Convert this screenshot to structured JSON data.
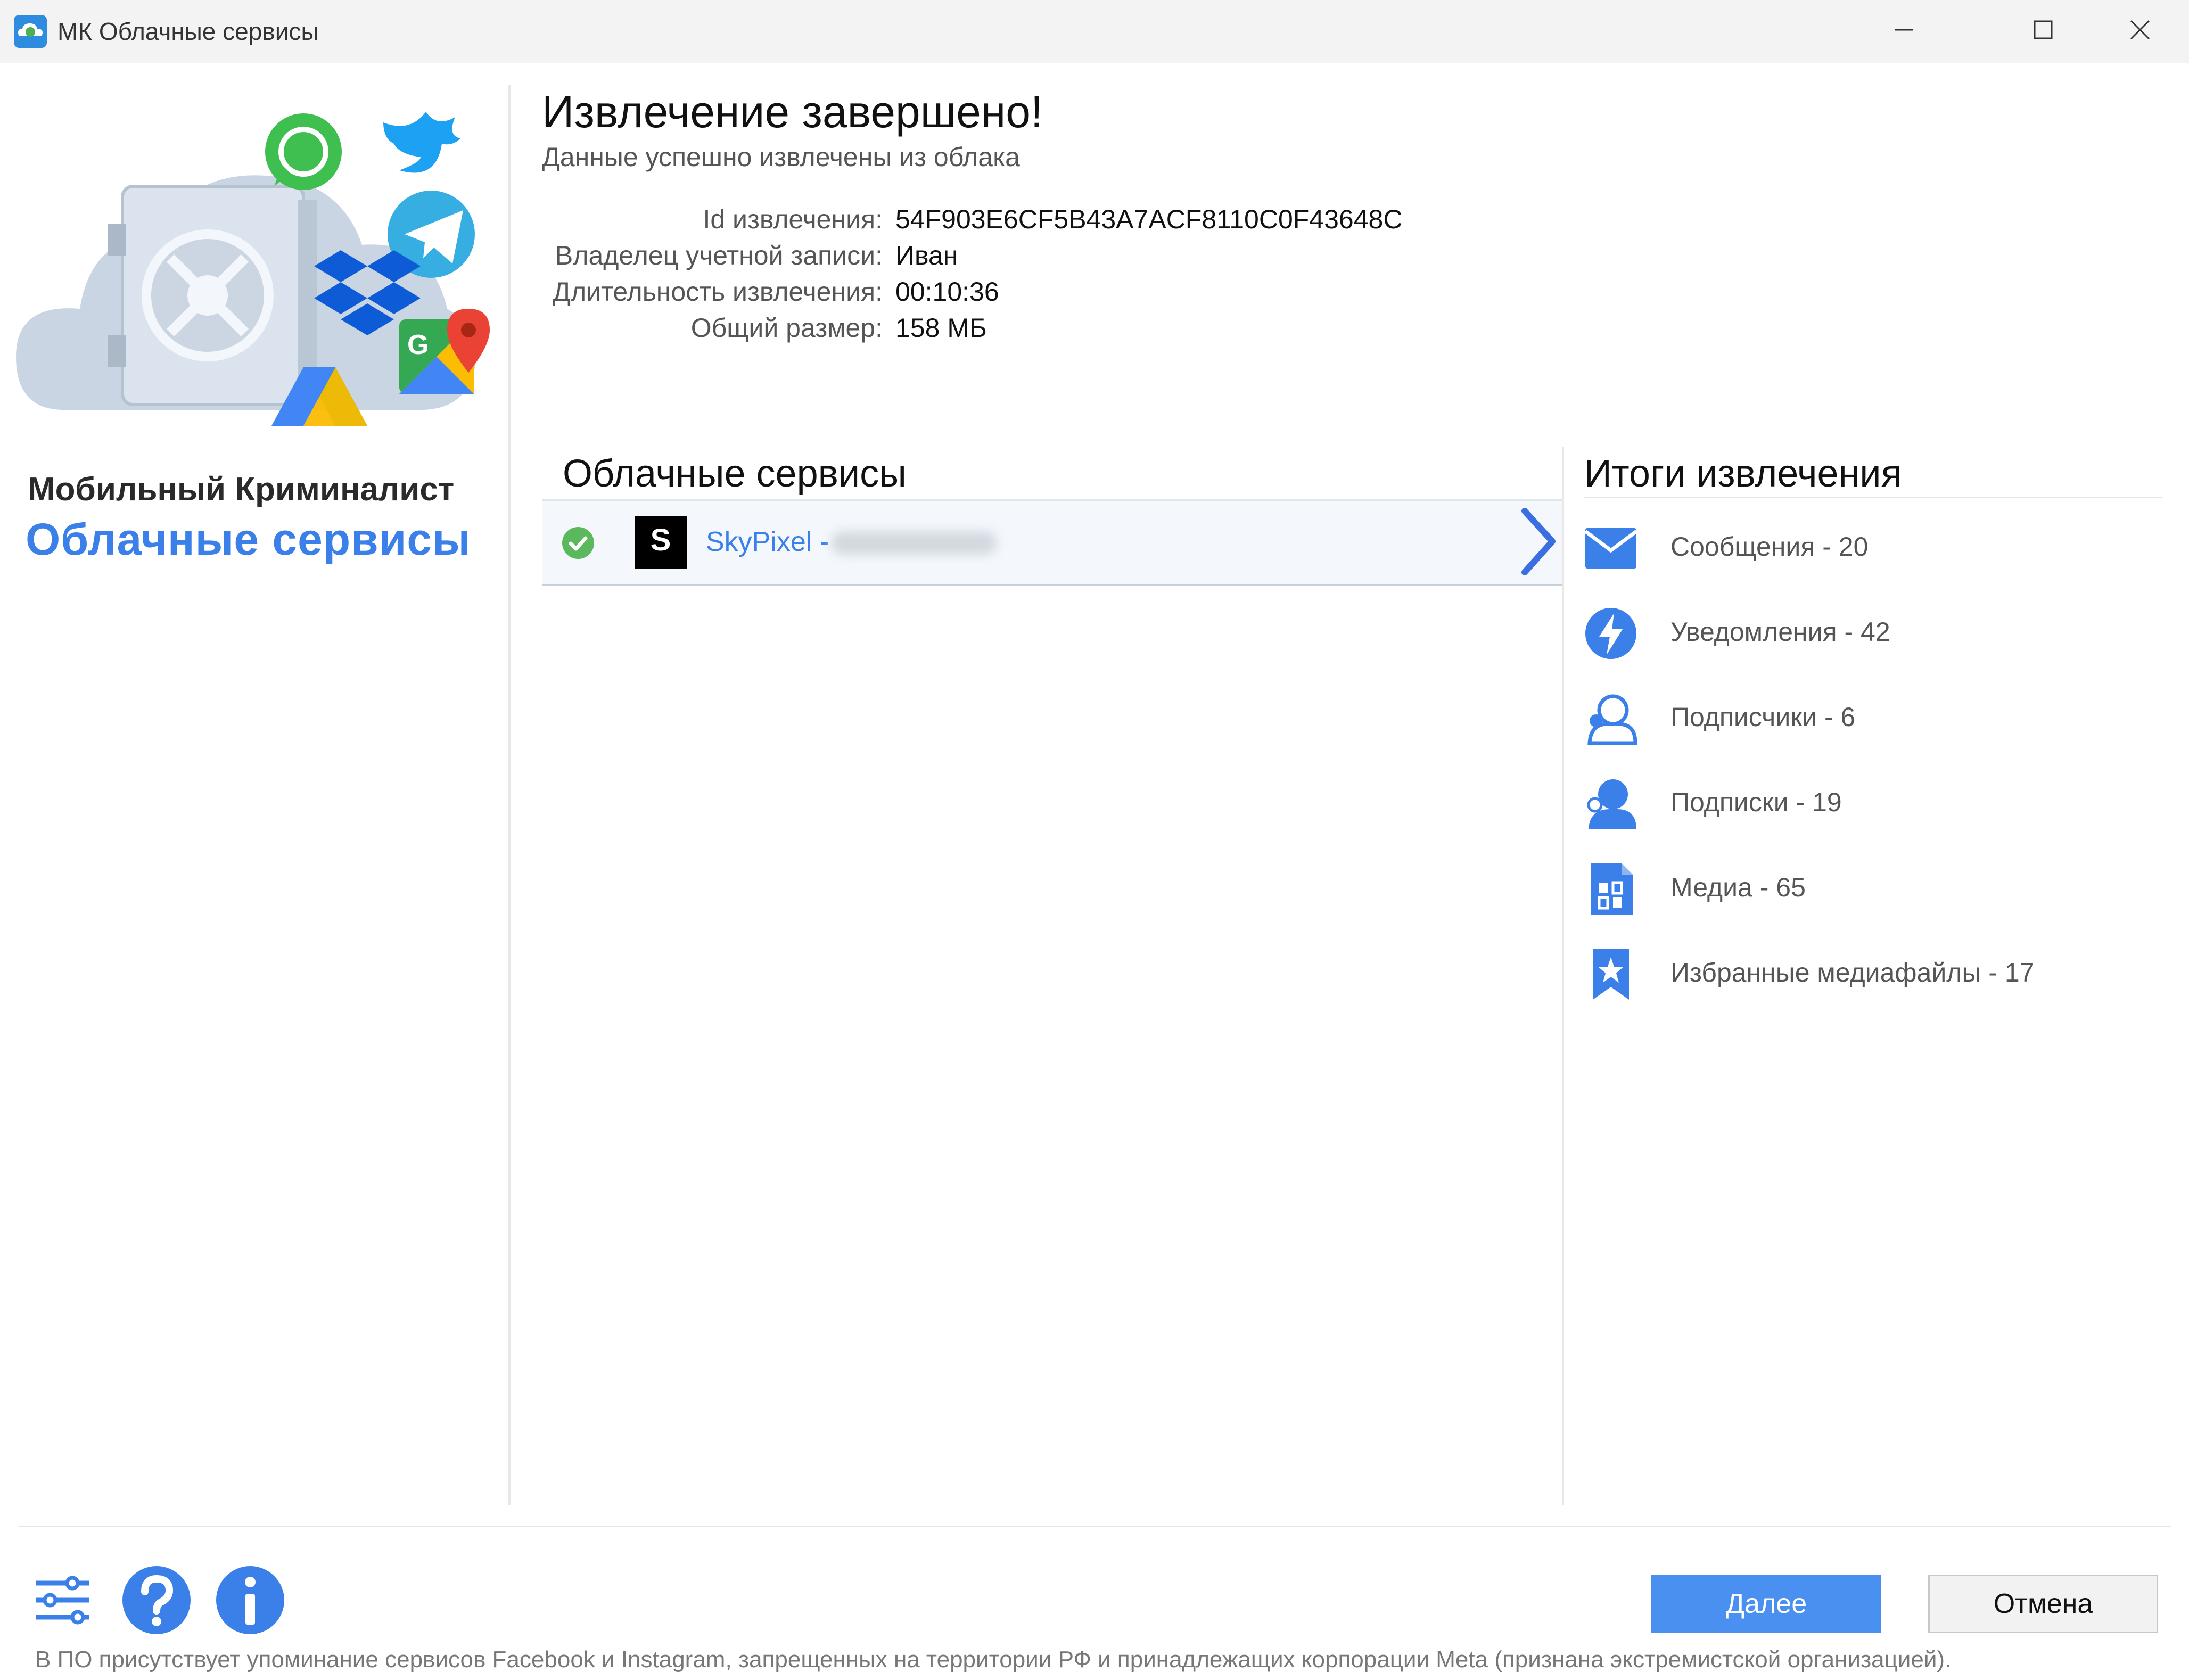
{
  "window": {
    "title": "МК Облачные сервисы",
    "controls": [
      "minimize-icon",
      "maximize-icon",
      "close-icon"
    ]
  },
  "branding": {
    "line1": "Мобильный Криминалист",
    "line2": "Облачные сервисы",
    "accent_color": "#3b7fe8"
  },
  "header": {
    "title": "Извлечение завершено!",
    "subtitle": "Данные успешно извлечены из облака"
  },
  "info": [
    {
      "label": "Id извлечения:",
      "value": "54F903E6CF5B43A7ACF8110C0F43648C"
    },
    {
      "label": "Владелец учетной записи:",
      "value": "Иван"
    },
    {
      "label": "Длительность извлечения:",
      "value": "00:10:36"
    },
    {
      "label": "Общий размер:",
      "value": "158 МБ"
    }
  ],
  "services": {
    "title": "Облачные сервисы",
    "items": [
      {
        "name": "SkyPixel -",
        "status": "success",
        "logo_letter": "S"
      }
    ]
  },
  "summary": {
    "title": "Итоги извлечения",
    "items": [
      {
        "label": "Сообщения - 20",
        "icon": "envelope-icon"
      },
      {
        "label": "Уведомления - 42",
        "icon": "lightning-icon"
      },
      {
        "label": "Подписчики - 6",
        "icon": "follower-icon"
      },
      {
        "label": "Подписки - 19",
        "icon": "subscription-icon"
      },
      {
        "label": "Медиа - 65",
        "icon": "media-file-icon"
      },
      {
        "label": "Избранные медиафайлы - 17",
        "icon": "bookmark-star-icon"
      }
    ]
  },
  "footer": {
    "next_label": "Далее",
    "cancel_label": "Отмена",
    "disclaimer": "В ПО присутствует упоминание сервисов Facebook и Instagram, запрещенных на территории РФ и принадлежащих корпорации Meta (признана экстремистской организацией).",
    "icons": [
      "settings-sliders-icon",
      "help-icon",
      "info-icon"
    ]
  }
}
